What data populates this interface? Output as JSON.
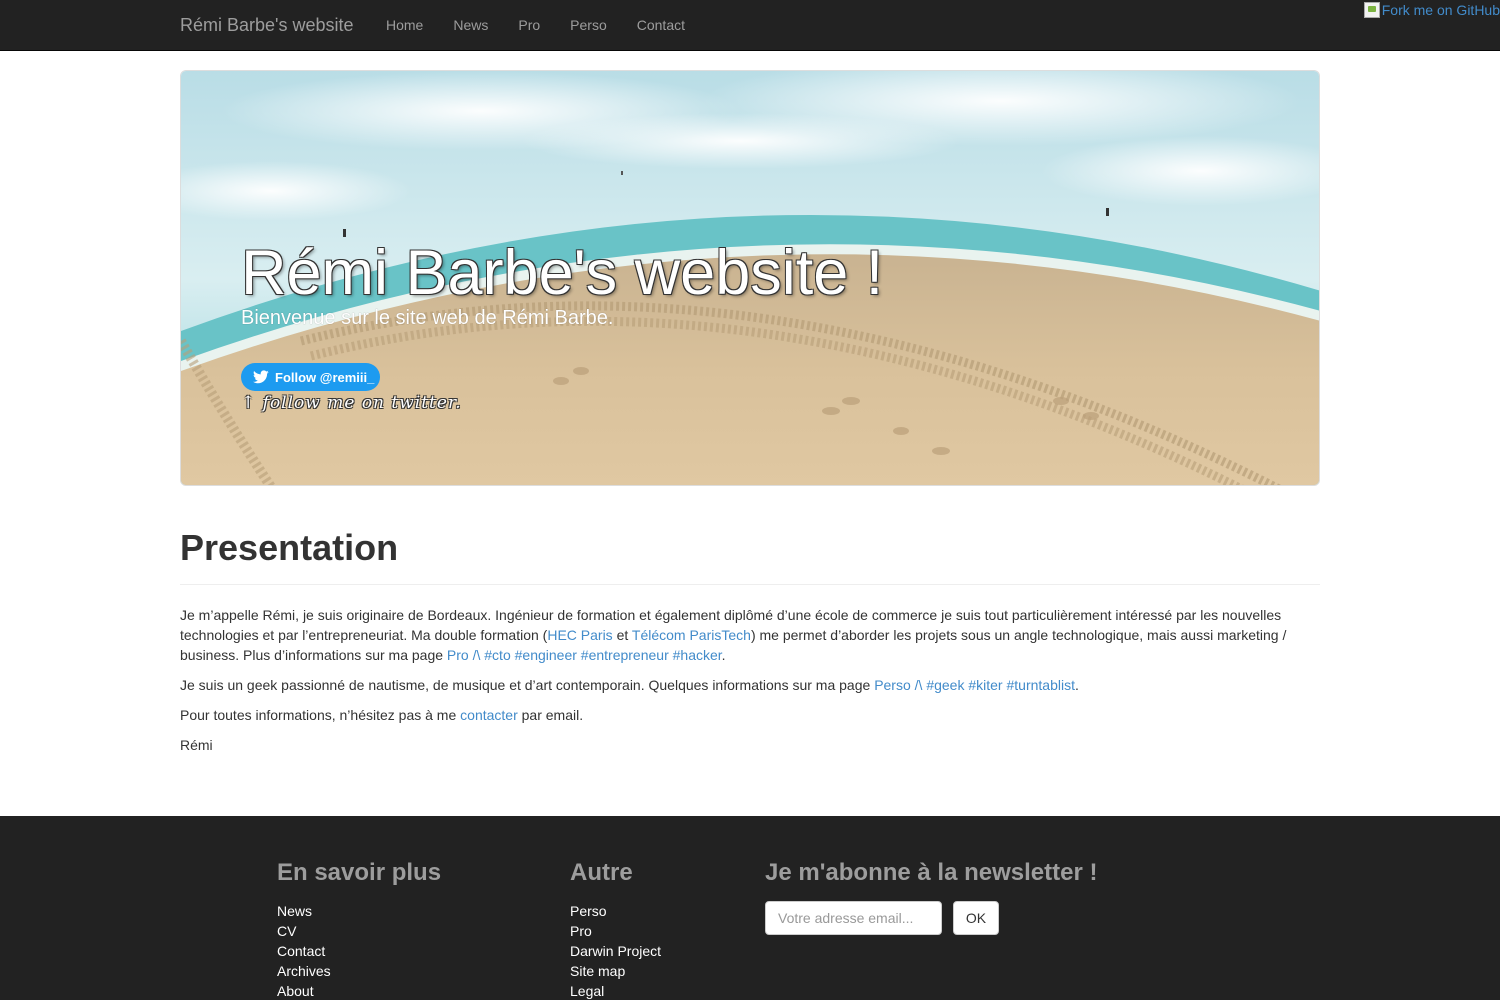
{
  "navbar": {
    "brand": "Rémi Barbe's website",
    "items": [
      {
        "label": "Home"
      },
      {
        "label": "News"
      },
      {
        "label": "Pro"
      },
      {
        "label": "Perso"
      },
      {
        "label": "Contact"
      }
    ],
    "fork_label": "Fork me on GitHub"
  },
  "jumbotron": {
    "title": "Rémi Barbe's website !",
    "lead": "Bienvenue sur le site web de Rémi Barbe.",
    "twitter_button": "Follow @remiii_",
    "follow_note": "↑ follow me on twitter."
  },
  "presentation": {
    "heading": "Presentation",
    "p1": {
      "t1": "Je m’appelle Rémi, je suis originaire de Bordeaux. Ingénieur de formation et également diplômé d’une école de commerce je suis tout particulièrement intéressé par les nouvelles technologies et par l’entrepreneuriat. Ma double formation (",
      "link_hec": "HEC Paris",
      "t2": " et ",
      "link_telecom": "Télécom ParisTech",
      "t3": ") me permet d’aborder les projets sous un angle technologique, mais aussi marketing / business. Plus d’informations sur ma page ",
      "link_pro": "Pro /\\ #cto #engineer #entrepreneur #hacker",
      "t4": "."
    },
    "p2": {
      "t1": "Je suis un geek passionné de nautisme, de musique et d’art contemporain. Quelques informations sur ma page ",
      "link_perso": "Perso /\\ #geek #kiter #turntablist",
      "t2": "."
    },
    "p3": {
      "t1": "Pour toutes informations, n’hésitez pas à me ",
      "link_contact": "contacter",
      "t2": " par email."
    },
    "signature": "Rémi"
  },
  "footer": {
    "col1": {
      "heading": "En savoir plus",
      "links": [
        "News",
        "CV",
        "Contact",
        "Archives",
        "About"
      ]
    },
    "col2": {
      "heading": "Autre",
      "links": [
        "Perso",
        "Pro",
        "Darwin Project",
        "Site map",
        "Legal"
      ]
    },
    "newsletter": {
      "heading": "Je m'abonne à la newsletter !",
      "placeholder": "Votre adresse email...",
      "button": "OK"
    }
  },
  "colors": {
    "navbar_bg": "#222222",
    "link": "#428bca",
    "twitter": "#1d9bf0"
  }
}
